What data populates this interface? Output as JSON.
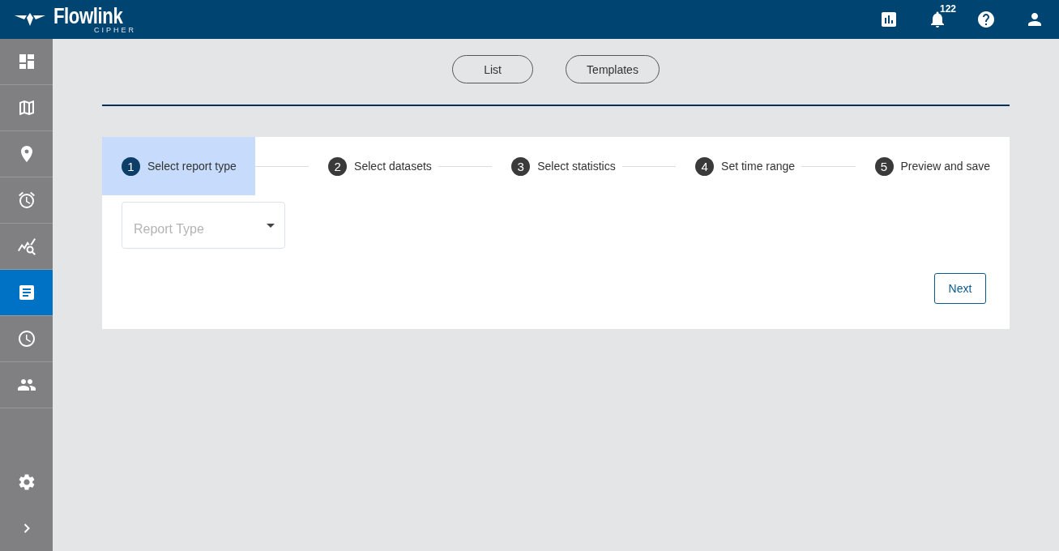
{
  "header": {
    "brand": "Flowlink",
    "sub_brand": "CIPHER",
    "notification_count": "122"
  },
  "sidebar": {
    "items": [
      {
        "selected": false
      },
      {
        "selected": false
      },
      {
        "selected": false
      },
      {
        "selected": false
      },
      {
        "selected": false
      },
      {
        "selected": true
      },
      {
        "selected": false
      },
      {
        "selected": false
      }
    ]
  },
  "view_tabs": [
    {
      "label": "List"
    },
    {
      "label": "Templates"
    }
  ],
  "stepper": {
    "steps": [
      {
        "number": "1",
        "label": "Select report type",
        "active": true
      },
      {
        "number": "2",
        "label": "Select datasets",
        "active": false
      },
      {
        "number": "3",
        "label": "Select statistics",
        "active": false
      },
      {
        "number": "4",
        "label": "Set time range",
        "active": false
      },
      {
        "number": "5",
        "label": "Preview and save",
        "active": false
      }
    ]
  },
  "report_type_field": {
    "placeholder": "Report Type"
  },
  "next_button": {
    "label": "Next"
  }
}
